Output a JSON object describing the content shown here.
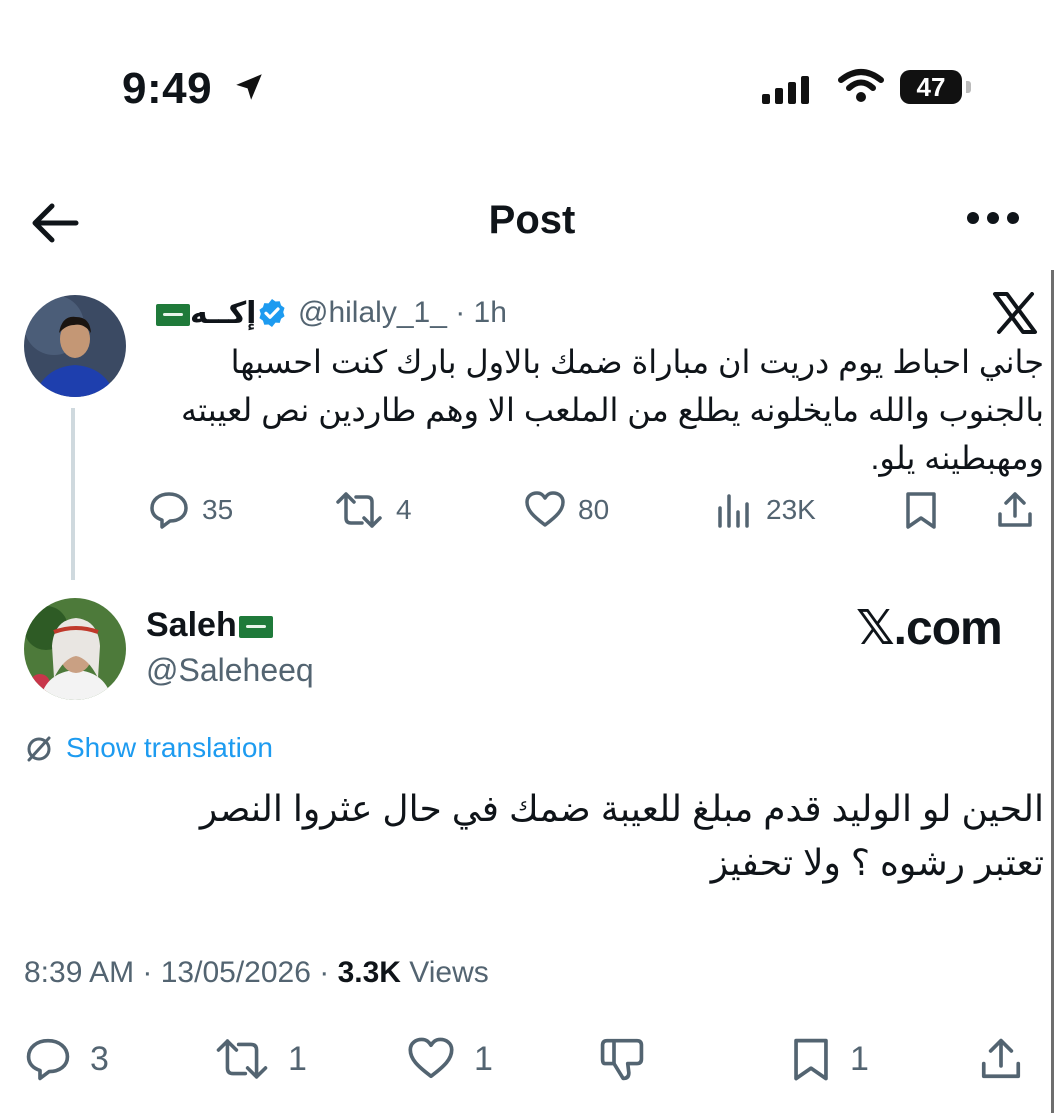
{
  "status_bar": {
    "time": "9:49",
    "battery": "47"
  },
  "header": {
    "title": "Post"
  },
  "quoted_post": {
    "display_name": "إكــه",
    "handle": "@hilaly_1_",
    "time": "· 1h",
    "text": "جاني احباط يوم دريت ان مباراة ضمك بالاول بارك كنت احسبها بالجنوب والله مايخلونه يطلع من الملعب الا وهم طاردين نص لعيبته ومهبطينه يلو.",
    "stats": {
      "replies": "35",
      "reposts": "4",
      "likes": "80",
      "views": "23K"
    }
  },
  "main_post": {
    "display_name": "Saleh",
    "handle": "@Saleheeq",
    "watermark": "𝕏.com",
    "show_translation": "Show translation",
    "text": "الحين لو الوليد قدم مبلغ للعيبة ضمك في حال عثروا النصر تعتبر رشوه ؟ ولا تحفيز",
    "meta": {
      "time": "8:39 AM",
      "date": "13/05/2026",
      "views_count": "3.3K",
      "views_label": "Views"
    },
    "stats": {
      "replies": "3",
      "reposts": "1",
      "likes": "1",
      "bookmarks": "1"
    }
  },
  "colors": {
    "accent": "#1d9bf0",
    "verified": "#1d9bf0",
    "text": "#0f1419",
    "secondary": "#536471",
    "flag": "#1f7a3a"
  },
  "icons": [
    "location-arrow-icon",
    "signal-icon",
    "wifi-icon",
    "back-arrow-icon",
    "more-icon",
    "verified-badge-icon",
    "x-logo-icon",
    "reply-icon",
    "repost-icon",
    "like-icon",
    "views-icon",
    "bookmark-icon",
    "share-icon",
    "globe-icon",
    "downvote-icon"
  ]
}
